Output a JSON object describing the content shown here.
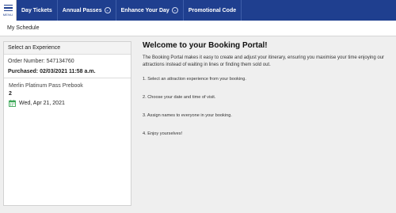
{
  "nav": {
    "menu_label": "MENU",
    "items": [
      {
        "label": "Day Tickets",
        "has_dropdown": false
      },
      {
        "label": "Annual Passes",
        "has_dropdown": true
      },
      {
        "label": "Enhance Your Day",
        "has_dropdown": true
      },
      {
        "label": "Promotional Code",
        "has_dropdown": false
      }
    ]
  },
  "schedule": {
    "title": "My Schedule"
  },
  "left_panel": {
    "header": "Select an Experience",
    "order_number": "Order Number: 547134760",
    "purchased": "Purchased: 02/03/2021 11:58 a.m.",
    "ticket": {
      "name": "Merlin Platinum Pass Prebook",
      "quantity": "2",
      "date": "Wed, Apr 21, 2021"
    }
  },
  "main": {
    "title": "Welcome to your Booking Portal!",
    "intro": "The Booking Portal makes it easy to create and adjust your itinerary, ensuring you maximise your time enjoying our attractions instead of waiting in lines or finding them sold out.",
    "steps": [
      "1. Select an attraction experience from your booking.",
      "2. Choose your date and time of visit.",
      "3. Assign names to everyone in your booking.",
      "4. Enjoy yourselves!"
    ]
  },
  "colors": {
    "nav_bg": "#1f3f8f",
    "calendar_icon": "#3aa655",
    "page_bg": "#efefef"
  },
  "icons": [
    "menu-icon",
    "chevron-down-icon",
    "calendar-icon"
  ]
}
